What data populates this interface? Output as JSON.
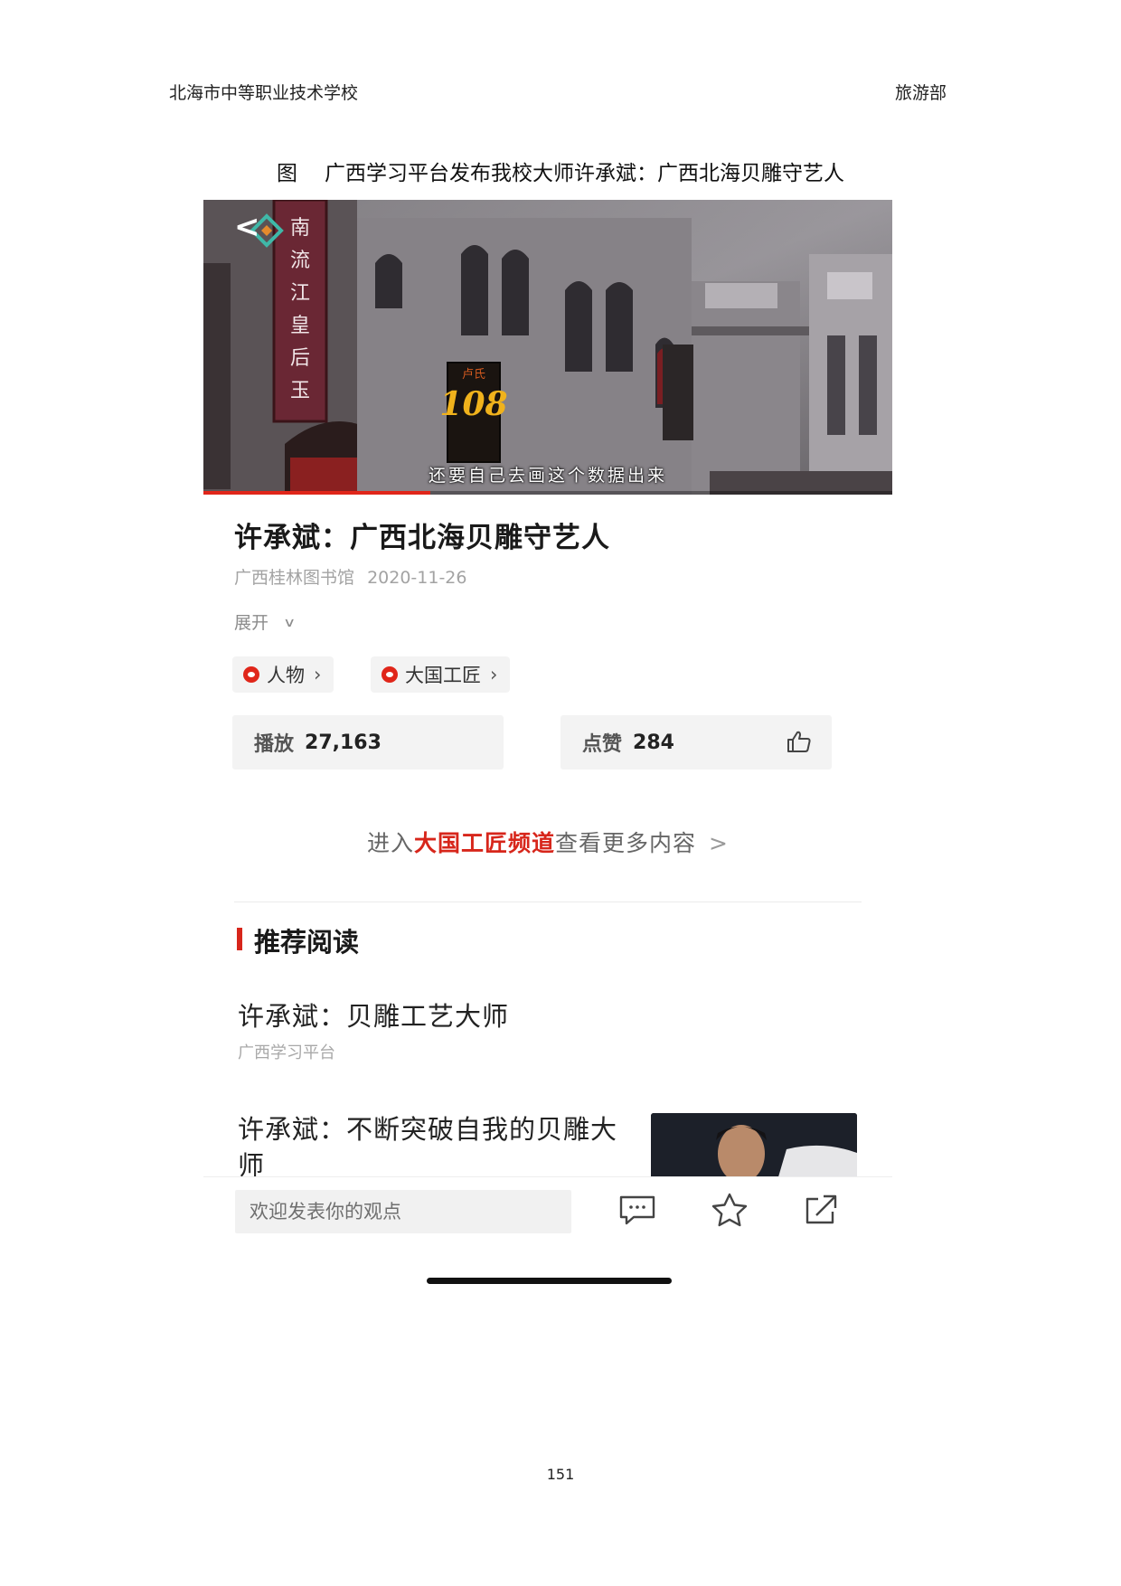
{
  "header": {
    "school": "北海市中等职业技术学校",
    "department": "旅游部"
  },
  "caption": {
    "prefix": "图",
    "text": "广西学习平台发布我校大师许承斌：广西北海贝雕守艺人"
  },
  "video": {
    "sign_text": "南流江皇后玉",
    "shop_sign_top": "卢氏",
    "shop_sign_number": "108",
    "subtitle": "还要自己去画这个数据出来",
    "progress_fraction": 0.33
  },
  "article": {
    "title": "许承斌：广西北海贝雕守艺人",
    "source": "广西桂林图书馆",
    "date": "2020-11-26",
    "expand_label": "展开"
  },
  "tags": [
    {
      "label": "人物"
    },
    {
      "label": "大国工匠"
    }
  ],
  "stats": {
    "plays_label": "播放",
    "plays_value": "27,163",
    "likes_label": "点赞",
    "likes_value": "284"
  },
  "channel_link": {
    "prefix": "进入",
    "highlight": "大国工匠频道",
    "suffix": "查看更多内容"
  },
  "recommended": {
    "heading": "推荐阅读",
    "items": [
      {
        "title": "许承斌：贝雕工艺大师",
        "source": "广西学习平台"
      },
      {
        "title": "许承斌：不断突破自我的贝雕大师"
      }
    ]
  },
  "bottom_bar": {
    "comment_placeholder": "欢迎发表你的观点"
  },
  "page_number": "151"
}
